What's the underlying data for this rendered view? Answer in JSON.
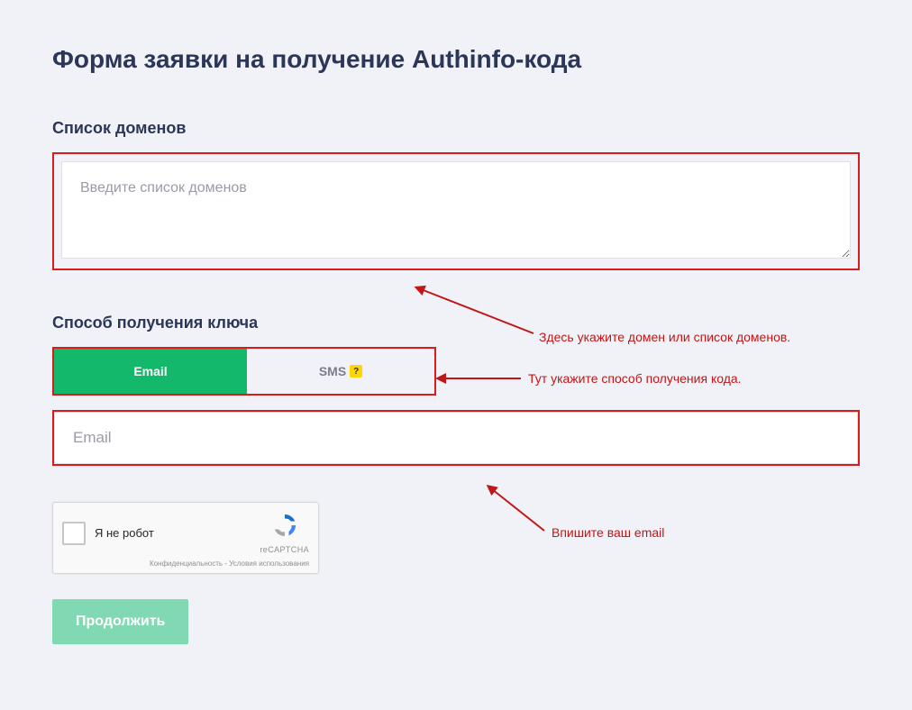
{
  "heading": "Форма заявки на получение Authinfo-кода",
  "domains": {
    "label": "Список доменов",
    "placeholder": "Введите список доменов"
  },
  "method": {
    "label": "Способ получения ключа",
    "tab_email": "Email",
    "tab_sms": "SMS",
    "help_symbol": "?"
  },
  "email_input": {
    "placeholder": "Email"
  },
  "recaptcha": {
    "checkbox_label": "Я не робот",
    "brand": "reCAPTCHA",
    "terms_privacy": "Конфиденциальность",
    "terms_sep": " - ",
    "terms_usage": "Условия использования"
  },
  "submit": "Продолжить",
  "annotations": {
    "domains": "Здесь укажите домен или список доменов.",
    "method": "Тут укажите способ получения кода.",
    "email": "Впишите ваш email"
  }
}
